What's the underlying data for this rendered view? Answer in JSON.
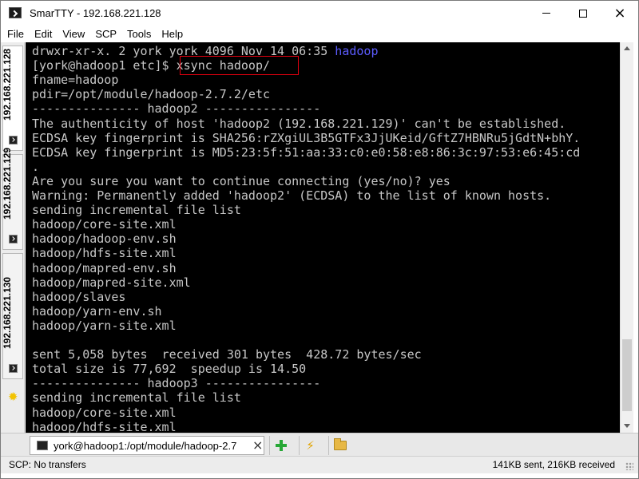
{
  "window": {
    "title": "SmarTTY - 192.168.221.128",
    "controls": {
      "minimize": "minimize",
      "maximize": "maximize",
      "close": "×"
    }
  },
  "menu": {
    "items": [
      "File",
      "Edit",
      "View",
      "SCP",
      "Tools",
      "Help"
    ]
  },
  "side_tabs": [
    {
      "label": "192.168.221.128",
      "active": true,
      "icon": "terminal-icon"
    },
    {
      "label": "192.168.221.129",
      "active": false,
      "icon": "terminal-icon"
    },
    {
      "label": "192.168.221.130",
      "active": false,
      "icon": "terminal-icon"
    }
  ],
  "side_tools": {
    "icon": "sun-icon",
    "glyph": "✹"
  },
  "terminal": {
    "lines": [
      {
        "text": "drwxr-xr-x. 2 york york 4096 Nov 14 06:35 ",
        "highlight": "hadoop"
      },
      {
        "text": "[york@hadoop1 etc]$ xsync hadoop/"
      },
      {
        "text": "fname=hadoop"
      },
      {
        "text": "pdir=/opt/module/hadoop-2.7.2/etc"
      },
      {
        "text": "--------------- hadoop2 ----------------"
      },
      {
        "text": "The authenticity of host 'hadoop2 (192.168.221.129)' can't be established."
      },
      {
        "text": "ECDSA key fingerprint is SHA256:rZXgiUL3B5GTFx3JjUKeid/GftZ7HBNRu5jGdtN+bhY."
      },
      {
        "text": "ECDSA key fingerprint is MD5:23:5f:51:aa:33:c0:e0:58:e8:86:3c:97:53:e6:45:cd"
      },
      {
        "text": "."
      },
      {
        "text": "Are you sure you want to continue connecting (yes/no)? yes"
      },
      {
        "text": "Warning: Permanently added 'hadoop2' (ECDSA) to the list of known hosts."
      },
      {
        "text": "sending incremental file list"
      },
      {
        "text": "hadoop/core-site.xml"
      },
      {
        "text": "hadoop/hadoop-env.sh"
      },
      {
        "text": "hadoop/hdfs-site.xml"
      },
      {
        "text": "hadoop/mapred-env.sh"
      },
      {
        "text": "hadoop/mapred-site.xml"
      },
      {
        "text": "hadoop/slaves"
      },
      {
        "text": "hadoop/yarn-env.sh"
      },
      {
        "text": "hadoop/yarn-site.xml"
      },
      {
        "text": ""
      },
      {
        "text": "sent 5,058 bytes  received 301 bytes  428.72 bytes/sec"
      },
      {
        "text": "total size is 77,692  speedup is 14.50"
      },
      {
        "text": "--------------- hadoop3 ----------------"
      },
      {
        "text": "sending incremental file list"
      },
      {
        "text": "hadoop/core-site.xml"
      },
      {
        "text": "hadoop/hdfs-site.xml"
      }
    ],
    "highlighted_command": "xsync hadoop/",
    "colors": {
      "background": "#000000",
      "text": "#c7c7c7",
      "directory": "#5c5cff",
      "annotation_box": "#e0000f"
    }
  },
  "session_bar": {
    "tab_label": "york@hadoop1:/opt/module/hadoop-2.7",
    "close": "×",
    "tools": [
      {
        "name": "new-session-button",
        "icon": "plus-icon"
      },
      {
        "name": "quick-command-button",
        "icon": "lightning-icon",
        "glyph": "⚡"
      },
      {
        "name": "file-browser-button",
        "icon": "folder-icon"
      }
    ]
  },
  "status": {
    "left": "SCP: No transfers",
    "right": "141KB sent, 216KB received"
  }
}
